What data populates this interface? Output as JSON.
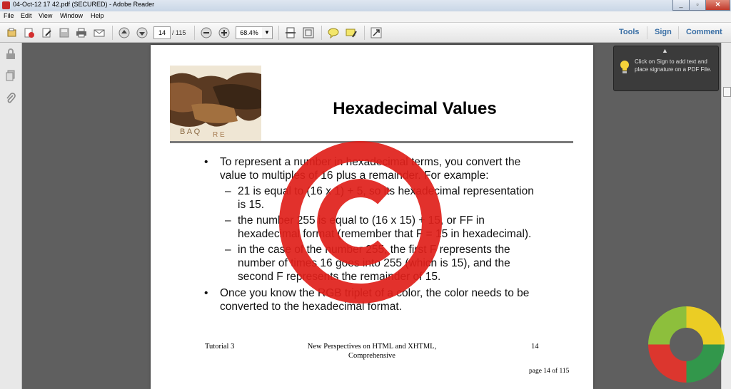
{
  "window": {
    "title": "04-Oct-12 17 42.pdf (SECURED) - Adobe Reader"
  },
  "menu": [
    "File",
    "Edit",
    "View",
    "Window",
    "Help"
  ],
  "toolbar": {
    "page_current": "14",
    "page_total": "/ 115",
    "zoom": "68.4%",
    "right": {
      "tools": "Tools",
      "sign": "Sign",
      "comment": "Comment"
    }
  },
  "tooltip": {
    "text": "Click on Sign to add text and place signature on a PDF File."
  },
  "slide": {
    "title": "Hexadecimal Values",
    "bullet1_l1": "To represent a number in hexadecimal terms, you convert the",
    "bullet1_l2": "value to multiples of 16 plus a remainder.  For example:",
    "sub1_l1": "21 is equal to (16 x 1) + 5, so its hexadecimal representation",
    "sub1_l2": "is 15.",
    "sub2_l1": "the number 255 is equal to (16 x 15) + 15, or FF in",
    "sub2_l2": "hexadecimal format (remember that F = 15 in hexadecimal).",
    "sub3_l1": "in the case of the number 255, the first F represents the",
    "sub3_l2": "number of times 16 goes into 255 (which is 15), and the",
    "sub3_l3": "second F represents the remainder of 15.",
    "bullet2_l1": "Once you know the RGB triplet of a color, the color needs to be",
    "bullet2_l2": "converted to the hexadecimal format.",
    "bullet_char": "•",
    "dash_char": "–"
  },
  "footer": {
    "left": "Tutorial 3",
    "center_l1": "New Perspectives on HTML and XHTML,",
    "center_l2": "Comprehensive",
    "right": "14",
    "page_label": "page 14 of 115"
  },
  "colors": {
    "watermark": "#e0201a",
    "link": "#3a6fa5"
  },
  "icons": [
    "open-icon",
    "create-pdf-icon",
    "edit-icon",
    "save-icon",
    "print-icon",
    "email-icon",
    "prev-page-icon",
    "next-page-icon",
    "zoom-out-icon",
    "zoom-in-icon",
    "fit-page-icon",
    "full-screen-icon",
    "comment-icon",
    "highlight-icon",
    "expand-icon",
    "lock-icon",
    "pages-icon",
    "attachment-icon",
    "lightbulb-icon"
  ]
}
